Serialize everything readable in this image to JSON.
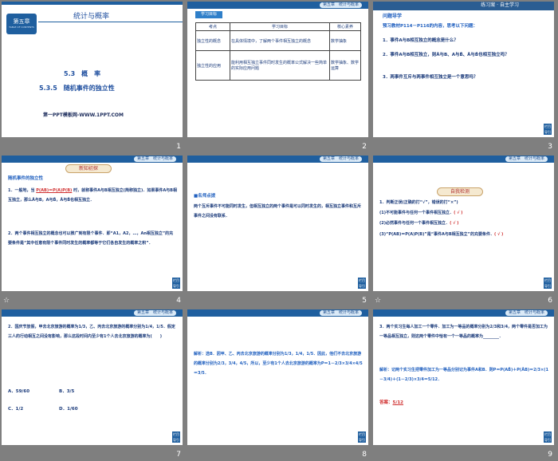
{
  "slides": [
    {
      "number": "1",
      "chapter_badge": "第五章",
      "chapter_sub": "TABLE OF CONTENTS",
      "chapter_title": "统计与概率",
      "section": "5.3　概　率",
      "subsection": "5.3.5　随机事件的独立性",
      "footer": "第一PPT模板网-WWW.1PPT.COM"
    },
    {
      "number": "2",
      "chip": "第五章　统计与概率",
      "tab": "学习目标",
      "headers": [
        "考点",
        "学习目标",
        "核心素养"
      ],
      "rows": [
        [
          "独立性的概念",
          "在具体情境中，了解两个事件相互独立的概念",
          "数学抽象"
        ],
        [
          "独立性的应用",
          "能利用相互独立事件同时发生的概率公式解决一些简单的实际应用问题",
          "数学抽象、数学运算"
        ]
      ]
    },
    {
      "number": "3",
      "chip": "练习案 · 自主学习",
      "heading": "问题导学",
      "intro": "预习教材P114－P116的内容，思考以下问题：",
      "q1": "1．事件A与B相互独立的概念是什么？",
      "q2": "2．事件A与B相互独立，则Ā与B、A与B̄、Ā与B̄也相互独立吗？",
      "q3": "3．两事件互斥与两事件相互独立是一个意思吗？"
    },
    {
      "number": "4",
      "chip": "第五章　统计与概率",
      "banner": "新知初探",
      "title": "随机事件的独立性",
      "p1": "1．一般地，当",
      "formula": "P(AB)＝P(A)P(B)",
      "p1b": "时，就称事件A与B相互独立(简称独立)．如果事件A与B相互独立，那么Ā与B，A与B̄，Ā与B̄也相互独立．",
      "p2": "2．两个事件相互独立的概念也可以推广到有限个事件．即“A1，A2，…，An相互独立”的充要条件是“其中任意有限个事件同时发生的概率都等于它们各自发生的概率之积”．"
    },
    {
      "number": "5",
      "chip": "第五章　统计与概率",
      "title": "■名师点拨",
      "text": "两个互斥事件不可能同时发生，但相互独立的两个事件是可以同时发生的，相互独立事件和互斥事件之间没有联系．"
    },
    {
      "number": "6",
      "chip": "第五章　统计与概率",
      "banner": "自我检测",
      "q": "1．判断正误(正确的打“√”，错误的打“×”)",
      "l1": "(1)不可能事件与任何一个事件相互独立．",
      "l2": "(2)必然事件与任何一个事件相互独立．",
      "l3": "(3)“P(AB)＝P(A)P(B)”是“事件A与B相互独立”的充要条件．",
      "a1": "( √ )",
      "a2": "( √ )",
      "a3": "( √ )"
    },
    {
      "number": "7",
      "chip": "第五章　统计与概率",
      "text": "2．国庆节放假，甲去北京旅游的概率为1/3，乙、丙去北京旅游的概率分别为1/4，1/5．假定三人的行动相互之间没有影响，那么这段时间内至少有1个人去北京旅游的概率为(　　)",
      "opts": [
        "A．59/60",
        "B．3/5",
        "C．1/2",
        "D．1/60"
      ]
    },
    {
      "number": "8",
      "chip": "第五章　统计与概率",
      "text": "解析：选B．因甲、乙、丙去北京旅游的概率分别为1/3，1/4，1/5．因此，他们不去北京旅游的概率分别为2/3，3/4，4/5，所以，至少有1个人去北京旅游的概率为P＝1－2/3×3/4×4/5＝3/5．"
    },
    {
      "number": "9",
      "chip": "第五章　统计与概率",
      "q": "3．两个实习生每人加工一个零件．加工为一等品的概率分别为2/3和3/4，两个零件是否加工为一等品相互独立，则这两个零件中恰有一个一等品的概率为________．",
      "sol": "解析：记两个实习生把零件加工为一等品分别记为事件A和B．则P＝P(AB̄)＋P(ĀB)＝2/3×(1－3/4)＋(1－2/3)×3/4＝5/12．",
      "ans_label": "答案：",
      "ans": "5/12"
    }
  ],
  "nav_label": "栏目导引"
}
